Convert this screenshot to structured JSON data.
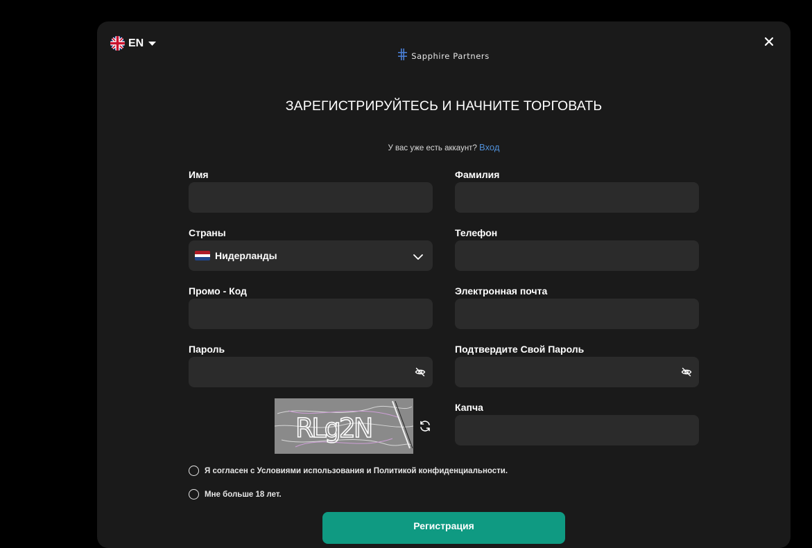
{
  "language": {
    "code": "EN"
  },
  "brand": {
    "name": "Sapphire Partners",
    "accent": "#4a7fd6"
  },
  "title": "ЗАРЕГИСТРИРУЙТЕСЬ И НАЧНИТЕ ТОРГОВАТЬ",
  "login_prompt": {
    "text": "У вас уже есть аккаунт?",
    "link": "Вход"
  },
  "form": {
    "first_name": {
      "label": "Имя",
      "value": ""
    },
    "last_name": {
      "label": "Фамилия",
      "value": ""
    },
    "country": {
      "label": "Страны",
      "value": "Нидерланды"
    },
    "phone": {
      "label": "Телефон",
      "value": ""
    },
    "promo": {
      "label": "Промо - Код",
      "value": ""
    },
    "email": {
      "label": "Электронная почта",
      "value": ""
    },
    "password": {
      "label": "Пароль",
      "value": ""
    },
    "confirm_password": {
      "label": "Подтвердите Свой Пароль",
      "value": ""
    },
    "captcha": {
      "label": "Капча",
      "value": "",
      "image_text": "RLg2N"
    }
  },
  "checks": {
    "terms": "Я согласен с Условиями использования и Политикой конфиденциальности.",
    "age": "Мне больше 18 лет."
  },
  "submit_label": "Регистрация",
  "colors": {
    "background": "#000000",
    "panel": "#1a1a1a",
    "field": "#2b2b2b",
    "link": "#4f8fd8",
    "button": "#0f9a82"
  }
}
